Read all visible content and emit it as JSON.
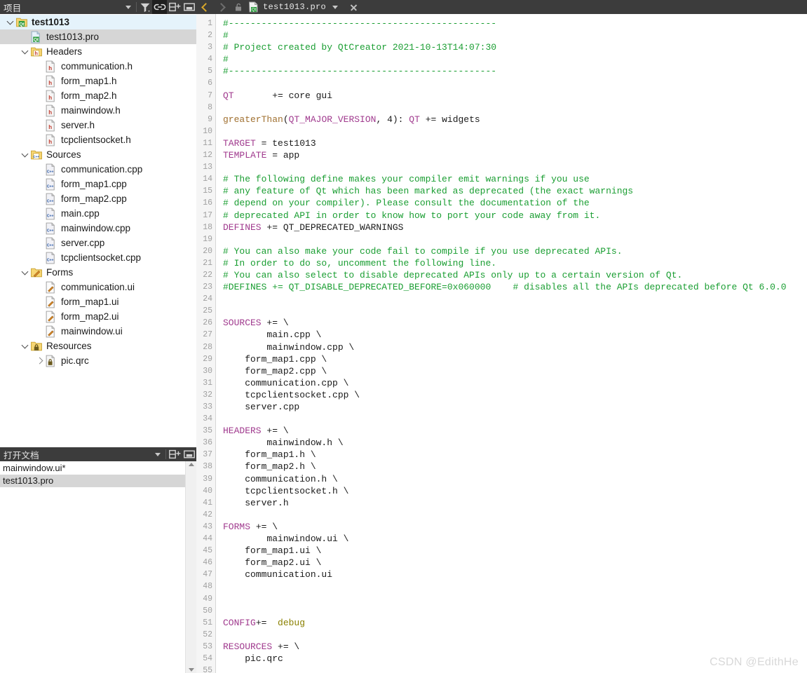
{
  "projects_panel": {
    "title": "项目",
    "toolbar": [
      {
        "name": "dropdown-chevron",
        "icon": "chevron-down-icon"
      },
      {
        "name": "filter",
        "icon": "filter-icon"
      },
      {
        "name": "link-with-editor",
        "icon": "link-icon",
        "active": true
      },
      {
        "name": "add-split",
        "icon": "split-add-icon"
      },
      {
        "name": "minimize-panel",
        "icon": "minimize-icon"
      }
    ],
    "tree": [
      {
        "label": "test1013",
        "depth": 0,
        "icon": "qt-project-icon",
        "twist": "down",
        "state": "highlight",
        "bold": true
      },
      {
        "label": "test1013.pro",
        "depth": 1,
        "icon": "qt-pro-file-icon",
        "twist": "none",
        "state": "selected",
        "bold": false
      },
      {
        "label": "Headers",
        "depth": 1,
        "icon": "headers-folder-icon",
        "twist": "down",
        "state": "none",
        "bold": false
      },
      {
        "label": "communication.h",
        "depth": 2,
        "icon": "header-file-icon",
        "twist": "none",
        "state": "none",
        "bold": false
      },
      {
        "label": "form_map1.h",
        "depth": 2,
        "icon": "header-file-icon",
        "twist": "none",
        "state": "none",
        "bold": false
      },
      {
        "label": "form_map2.h",
        "depth": 2,
        "icon": "header-file-icon",
        "twist": "none",
        "state": "none",
        "bold": false
      },
      {
        "label": "mainwindow.h",
        "depth": 2,
        "icon": "header-file-icon",
        "twist": "none",
        "state": "none",
        "bold": false
      },
      {
        "label": "server.h",
        "depth": 2,
        "icon": "header-file-icon",
        "twist": "none",
        "state": "none",
        "bold": false
      },
      {
        "label": "tcpclientsocket.h",
        "depth": 2,
        "icon": "header-file-icon",
        "twist": "none",
        "state": "none",
        "bold": false
      },
      {
        "label": "Sources",
        "depth": 1,
        "icon": "sources-folder-icon",
        "twist": "down",
        "state": "none",
        "bold": false
      },
      {
        "label": "communication.cpp",
        "depth": 2,
        "icon": "cpp-file-icon",
        "twist": "none",
        "state": "none",
        "bold": false
      },
      {
        "label": "form_map1.cpp",
        "depth": 2,
        "icon": "cpp-file-icon",
        "twist": "none",
        "state": "none",
        "bold": false
      },
      {
        "label": "form_map2.cpp",
        "depth": 2,
        "icon": "cpp-file-icon",
        "twist": "none",
        "state": "none",
        "bold": false
      },
      {
        "label": "main.cpp",
        "depth": 2,
        "icon": "cpp-file-icon",
        "twist": "none",
        "state": "none",
        "bold": false
      },
      {
        "label": "mainwindow.cpp",
        "depth": 2,
        "icon": "cpp-file-icon",
        "twist": "none",
        "state": "none",
        "bold": false
      },
      {
        "label": "server.cpp",
        "depth": 2,
        "icon": "cpp-file-icon",
        "twist": "none",
        "state": "none",
        "bold": false
      },
      {
        "label": "tcpclientsocket.cpp",
        "depth": 2,
        "icon": "cpp-file-icon",
        "twist": "none",
        "state": "none",
        "bold": false
      },
      {
        "label": "Forms",
        "depth": 1,
        "icon": "forms-folder-icon",
        "twist": "down",
        "state": "none",
        "bold": false
      },
      {
        "label": "communication.ui",
        "depth": 2,
        "icon": "ui-file-icon",
        "twist": "none",
        "state": "none",
        "bold": false
      },
      {
        "label": "form_map1.ui",
        "depth": 2,
        "icon": "ui-file-icon",
        "twist": "none",
        "state": "none",
        "bold": false
      },
      {
        "label": "form_map2.ui",
        "depth": 2,
        "icon": "ui-file-icon",
        "twist": "none",
        "state": "none",
        "bold": false
      },
      {
        "label": "mainwindow.ui",
        "depth": 2,
        "icon": "ui-file-icon",
        "twist": "none",
        "state": "none",
        "bold": false
      },
      {
        "label": "Resources",
        "depth": 1,
        "icon": "resources-folder-icon",
        "twist": "down",
        "state": "none",
        "bold": false
      },
      {
        "label": "pic.qrc",
        "depth": 2,
        "icon": "qrc-file-icon",
        "twist": "right",
        "state": "none",
        "bold": false
      }
    ]
  },
  "open_documents_panel": {
    "title": "打开文档",
    "toolbar": [
      {
        "name": "dropdown-chevron",
        "icon": "chevron-down-icon"
      },
      {
        "name": "add-split",
        "icon": "split-add-icon"
      },
      {
        "name": "minimize-panel",
        "icon": "minimize-icon"
      }
    ],
    "documents": [
      {
        "label": "mainwindow.ui*",
        "selected": false
      },
      {
        "label": "test1013.pro",
        "selected": true
      }
    ]
  },
  "editor_toolbar": {
    "back_icon": "chevron-left-icon",
    "forward_icon": "chevron-right-icon",
    "lock_icon": "unlocked-padlock-icon",
    "file_icon": "qt-pro-file-icon",
    "filename": "test1013.pro",
    "dropdown_icon": "chevron-down-icon",
    "close_icon": "close-icon"
  },
  "editor": {
    "first_line": 1,
    "last_line": 55,
    "line_numbers": [
      1,
      2,
      3,
      4,
      5,
      6,
      7,
      8,
      9,
      10,
      11,
      12,
      13,
      14,
      15,
      16,
      17,
      18,
      19,
      20,
      21,
      22,
      23,
      24,
      25,
      26,
      27,
      28,
      29,
      30,
      31,
      32,
      33,
      34,
      35,
      36,
      37,
      38,
      39,
      40,
      41,
      42,
      43,
      44,
      45,
      46,
      47,
      48,
      49,
      50,
      51,
      52,
      53,
      54,
      55
    ],
    "lines": [
      {
        "n": 1,
        "tokens": [
          {
            "t": "#-------------------------------------------------",
            "c": "com"
          }
        ]
      },
      {
        "n": 2,
        "tokens": [
          {
            "t": "#",
            "c": "com"
          }
        ]
      },
      {
        "n": 3,
        "tokens": [
          {
            "t": "# Project created by QtCreator 2021-10-13T14:07:30",
            "c": "com"
          }
        ]
      },
      {
        "n": 4,
        "tokens": [
          {
            "t": "#",
            "c": "com"
          }
        ]
      },
      {
        "n": 5,
        "tokens": [
          {
            "t": "#-------------------------------------------------",
            "c": "com"
          }
        ]
      },
      {
        "n": 6,
        "tokens": []
      },
      {
        "n": 7,
        "tokens": [
          {
            "t": "QT",
            "c": "kw"
          },
          {
            "t": "       += core gui",
            "c": "txt"
          }
        ]
      },
      {
        "n": 8,
        "tokens": []
      },
      {
        "n": 9,
        "tokens": [
          {
            "t": "greaterThan",
            "c": "func"
          },
          {
            "t": "(",
            "c": "txt"
          },
          {
            "t": "QT_MAJOR_VERSION",
            "c": "kw"
          },
          {
            "t": ", 4): ",
            "c": "txt"
          },
          {
            "t": "QT",
            "c": "kw"
          },
          {
            "t": " += widgets",
            "c": "txt"
          }
        ]
      },
      {
        "n": 10,
        "tokens": []
      },
      {
        "n": 11,
        "tokens": [
          {
            "t": "TARGET",
            "c": "kw"
          },
          {
            "t": " = test1013",
            "c": "txt"
          }
        ]
      },
      {
        "n": 12,
        "tokens": [
          {
            "t": "TEMPLATE",
            "c": "kw"
          },
          {
            "t": " = app",
            "c": "txt"
          }
        ]
      },
      {
        "n": 13,
        "tokens": []
      },
      {
        "n": 14,
        "tokens": [
          {
            "t": "# The following define makes your compiler emit warnings if you use",
            "c": "com"
          }
        ]
      },
      {
        "n": 15,
        "tokens": [
          {
            "t": "# any feature of Qt which has been marked as deprecated (the exact warnings",
            "c": "com"
          }
        ]
      },
      {
        "n": 16,
        "tokens": [
          {
            "t": "# depend on your compiler). Please consult the documentation of the",
            "c": "com"
          }
        ]
      },
      {
        "n": 17,
        "tokens": [
          {
            "t": "# deprecated API in order to know how to port your code away from it.",
            "c": "com"
          }
        ]
      },
      {
        "n": 18,
        "tokens": [
          {
            "t": "DEFINES",
            "c": "kw"
          },
          {
            "t": " += QT_DEPRECATED_WARNINGS",
            "c": "txt"
          }
        ]
      },
      {
        "n": 19,
        "tokens": []
      },
      {
        "n": 20,
        "tokens": [
          {
            "t": "# You can also make your code fail to compile if you use deprecated APIs.",
            "c": "com"
          }
        ]
      },
      {
        "n": 21,
        "tokens": [
          {
            "t": "# In order to do so, uncomment the following line.",
            "c": "com"
          }
        ]
      },
      {
        "n": 22,
        "tokens": [
          {
            "t": "# You can also select to disable deprecated APIs only up to a certain version of Qt.",
            "c": "com"
          }
        ]
      },
      {
        "n": 23,
        "tokens": [
          {
            "t": "#DEFINES += QT_DISABLE_DEPRECATED_BEFORE=0x060000    # disables all the APIs deprecated before Qt 6.0.0",
            "c": "com"
          }
        ]
      },
      {
        "n": 24,
        "tokens": []
      },
      {
        "n": 25,
        "tokens": []
      },
      {
        "n": 26,
        "tokens": [
          {
            "t": "SOURCES",
            "c": "kw"
          },
          {
            "t": " += \\",
            "c": "txt"
          }
        ]
      },
      {
        "n": 27,
        "tokens": [
          {
            "t": "        main.cpp \\",
            "c": "txt"
          }
        ]
      },
      {
        "n": 28,
        "tokens": [
          {
            "t": "        mainwindow.cpp \\",
            "c": "txt"
          }
        ]
      },
      {
        "n": 29,
        "tokens": [
          {
            "t": "    form_map1.cpp \\",
            "c": "txt"
          }
        ]
      },
      {
        "n": 30,
        "tokens": [
          {
            "t": "    form_map2.cpp \\",
            "c": "txt"
          }
        ]
      },
      {
        "n": 31,
        "tokens": [
          {
            "t": "    communication.cpp \\",
            "c": "txt"
          }
        ]
      },
      {
        "n": 32,
        "tokens": [
          {
            "t": "    tcpclientsocket.cpp \\",
            "c": "txt"
          }
        ]
      },
      {
        "n": 33,
        "tokens": [
          {
            "t": "    server.cpp",
            "c": "txt"
          }
        ]
      },
      {
        "n": 34,
        "tokens": []
      },
      {
        "n": 35,
        "tokens": [
          {
            "t": "HEADERS",
            "c": "kw"
          },
          {
            "t": " += \\",
            "c": "txt"
          }
        ]
      },
      {
        "n": 36,
        "tokens": [
          {
            "t": "        mainwindow.h \\",
            "c": "txt"
          }
        ]
      },
      {
        "n": 37,
        "tokens": [
          {
            "t": "    form_map1.h \\",
            "c": "txt"
          }
        ]
      },
      {
        "n": 38,
        "tokens": [
          {
            "t": "    form_map2.h \\",
            "c": "txt"
          }
        ]
      },
      {
        "n": 39,
        "tokens": [
          {
            "t": "    communication.h \\",
            "c": "txt"
          }
        ]
      },
      {
        "n": 40,
        "tokens": [
          {
            "t": "    tcpclientsocket.h \\",
            "c": "txt"
          }
        ]
      },
      {
        "n": 41,
        "tokens": [
          {
            "t": "    server.h",
            "c": "txt"
          }
        ]
      },
      {
        "n": 42,
        "tokens": []
      },
      {
        "n": 43,
        "tokens": [
          {
            "t": "FORMS",
            "c": "kw"
          },
          {
            "t": " += \\",
            "c": "txt"
          }
        ]
      },
      {
        "n": 44,
        "tokens": [
          {
            "t": "        mainwindow.ui \\",
            "c": "txt"
          }
        ]
      },
      {
        "n": 45,
        "tokens": [
          {
            "t": "    form_map1.ui \\",
            "c": "txt"
          }
        ]
      },
      {
        "n": 46,
        "tokens": [
          {
            "t": "    form_map2.ui \\",
            "c": "txt"
          }
        ]
      },
      {
        "n": 47,
        "tokens": [
          {
            "t": "    communication.ui",
            "c": "txt"
          }
        ]
      },
      {
        "n": 48,
        "tokens": []
      },
      {
        "n": 49,
        "tokens": []
      },
      {
        "n": 50,
        "tokens": []
      },
      {
        "n": 51,
        "tokens": [
          {
            "t": "CONFIG",
            "c": "kw"
          },
          {
            "t": "+=  ",
            "c": "txt"
          },
          {
            "t": "debug",
            "c": "val"
          }
        ]
      },
      {
        "n": 52,
        "tokens": []
      },
      {
        "n": 53,
        "tokens": [
          {
            "t": "RESOURCES",
            "c": "kw"
          },
          {
            "t": " += \\",
            "c": "txt"
          }
        ]
      },
      {
        "n": 54,
        "tokens": [
          {
            "t": "    pic.qrc",
            "c": "txt"
          }
        ]
      },
      {
        "n": 55,
        "tokens": []
      }
    ]
  },
  "watermark": "CSDN @EdithHe",
  "colors": {
    "panel_header_bg": "#3c3c3c",
    "comment_green": "#1a9e32",
    "keyword_purple": "#a03a8e",
    "function_olive": "#a07030",
    "value_olive": "#8a8000",
    "tree_highlight": "#e5f3fb",
    "tree_selected": "#d6d6d6",
    "gutter_bg": "#f5f5f5"
  }
}
